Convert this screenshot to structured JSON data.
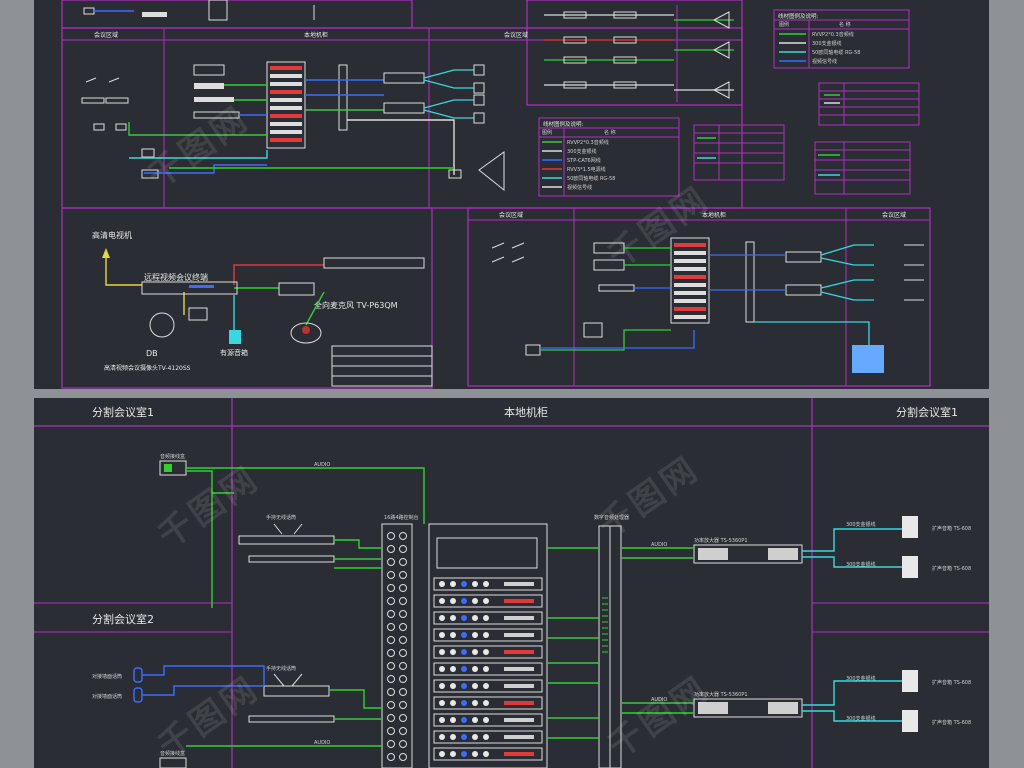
{
  "top_sheet": {
    "section_a": {
      "header_left": "会议区域",
      "header_mid": "本地机柜",
      "header_right": "会议区域"
    },
    "legend_a": {
      "title": "线材图例及说明:",
      "col_icon": "图例",
      "col_name": "名    称",
      "rows": [
        "RVVP2*0.3音频线",
        "300支金银线",
        "50欧同轴电缆 RG-58",
        "视频信号线"
      ]
    },
    "legend_b": {
      "title": "线材图例及说明:",
      "col_icon": "图例",
      "col_name": "名    称",
      "rows": [
        "RVVP2*0.3音频线",
        "300支金银线",
        "STP-CAT6网线",
        "RVV3*1.5电源线",
        "50欧同轴电缆 RG-58",
        "视频信号线"
      ]
    },
    "section_c": {
      "tv_label": "高清电视机",
      "terminal_label": "远程视频会议终端",
      "mic_label": "全向麦克风  TV-P63QM",
      "camera_label": "高清视频会议摄像头TV-4120SS",
      "speaker_label": "有源音箱",
      "db_label": "DB"
    },
    "section_d": {
      "header_left": "会议区域",
      "header_mid": "本地机柜",
      "header_right": "会议区域"
    }
  },
  "bottom_sheet": {
    "header_left": "分割会议室1",
    "header_mid": "本地机柜",
    "header_right": "分割会议室1",
    "room2_label": "分割会议室2",
    "rack_label": "16路4路控制台",
    "processor_label": "数字音频处理器",
    "wireless_mic_1": "手持无线话筒",
    "wireless_mic_2": "手持无线话筒",
    "amp_1": "功率放大器 TS-5360P1",
    "amp_2": "功率放大器 TS-5360P1",
    "speaker_1": "扩声音箱 TS-608",
    "speaker_2": "扩声音箱 TS-608",
    "speaker_3": "扩声音箱 TS-608",
    "speaker_4": "扩声音箱 TS-608",
    "cable_300": "300支金银线",
    "mic_in_1": "对接墙面话筒",
    "mic_in_2": "对接墙面话筒",
    "wall_panel_1": "音频接线盒",
    "wall_panel_2": "音频接线盒",
    "line_label": "AUDIO"
  },
  "watermark": "千图网",
  "colors": {
    "sheet_bg": "#2a2d33",
    "frame": "#b030c0",
    "wire_green": "#2fd12f",
    "wire_blue": "#3a6dff",
    "wire_cyan": "#36d9e0",
    "wire_red": "#e03a3a",
    "wire_yellow": "#e6d63a"
  }
}
